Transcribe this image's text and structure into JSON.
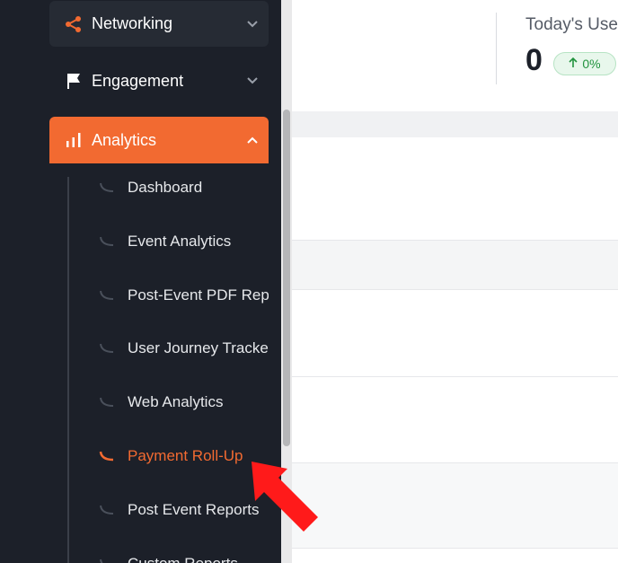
{
  "sidebar": {
    "nav": [
      {
        "label": "Networking",
        "icon": "share-icon",
        "expanded": false
      },
      {
        "label": "Engagement",
        "icon": "flag-icon",
        "expanded": false
      },
      {
        "label": "Analytics",
        "icon": "bar-chart-icon",
        "expanded": true
      }
    ],
    "analytics_items": [
      {
        "label": "Dashboard",
        "active": false
      },
      {
        "label": "Event Analytics",
        "active": false
      },
      {
        "label": "Post-Event PDF Repo",
        "active": false
      },
      {
        "label": "User Journey Tracker",
        "active": false
      },
      {
        "label": "Web Analytics",
        "active": false
      },
      {
        "label": "Payment Roll-Up",
        "active": true
      },
      {
        "label": "Post Event Reports",
        "active": false
      },
      {
        "label": "Custom Reports",
        "active": false
      }
    ]
  },
  "stats": {
    "title": "Today's Use",
    "value": "0",
    "change": "0%",
    "change_icon": "arrow-up-icon"
  },
  "colors": {
    "sidebar_bg": "#1c2029",
    "accent": "#f26a31",
    "positive": "#22933e",
    "annotation_arrow": "#ff1a1a"
  }
}
